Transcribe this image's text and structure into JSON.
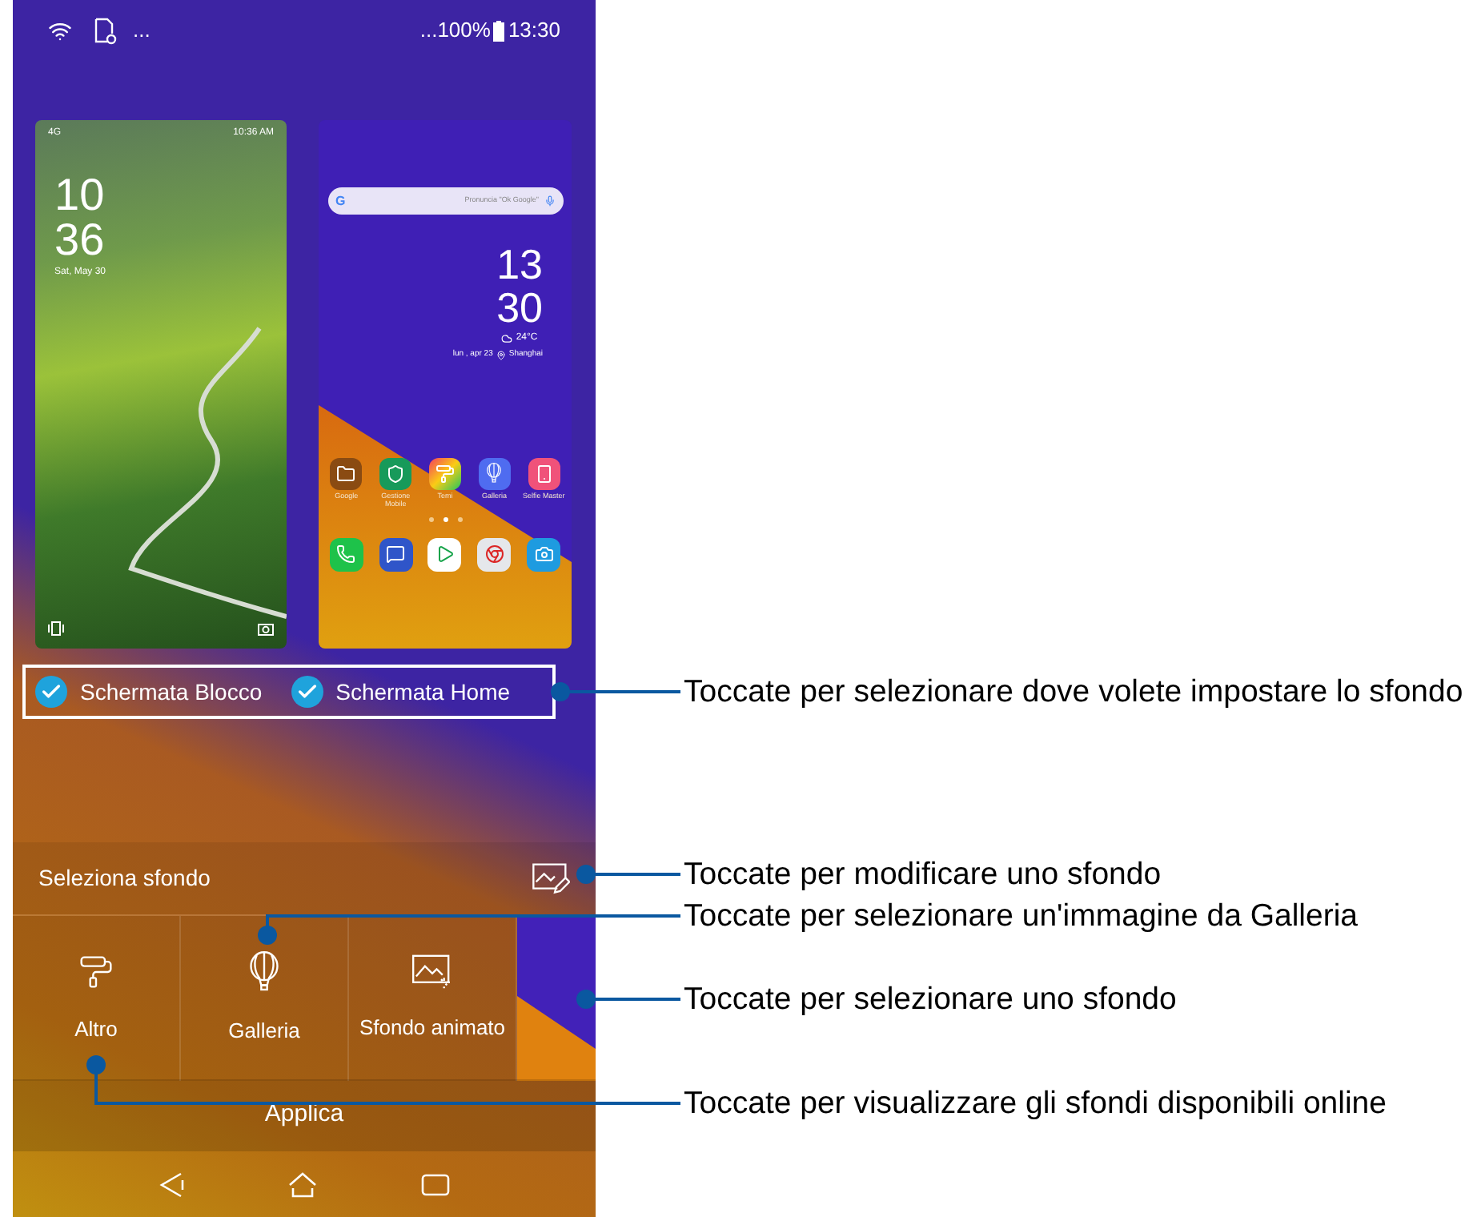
{
  "status_bar": {
    "left_more": "...",
    "right_more": "...",
    "battery": "100%",
    "time": "13:30"
  },
  "lock_preview": {
    "network": "4G",
    "time": "10:36 AM",
    "hour": "10",
    "minute": "36",
    "date": "Sat, May 30"
  },
  "home_preview": {
    "google_logo": "G",
    "search_placeholder": "Pronuncia \"Ok Google\"",
    "hour": "13",
    "minute": "30",
    "temperature": "24°C",
    "date": "lun , apr 23",
    "location": "Shanghai",
    "apps": [
      {
        "label": "Google"
      },
      {
        "label": "Gestione Mobile"
      },
      {
        "label": "Temi"
      },
      {
        "label": "Galleria"
      },
      {
        "label": "Selfie Master"
      }
    ],
    "page_dots": [
      {
        "selected": false
      },
      {
        "selected": true
      },
      {
        "selected": false
      }
    ]
  },
  "targets": [
    {
      "label": "Schermata Blocco",
      "checked": true
    },
    {
      "label": "Schermata Home",
      "checked": true
    }
  ],
  "section_title": "Seleziona sfondo",
  "options": [
    {
      "label": "Altro"
    },
    {
      "label": "Galleria"
    },
    {
      "label": "Sfondo animato"
    }
  ],
  "apply_button": "Applica",
  "callouts": [
    {
      "kind": "targets",
      "text": "Toccate per selezionare dove volete impostare lo sfondo"
    },
    {
      "kind": "edit",
      "text": "Toccate per modificare uno sfondo"
    },
    {
      "kind": "gallery",
      "text": "Toccate per selezionare un'immagine da Galleria"
    },
    {
      "kind": "wallpaper",
      "text": "Toccate per selezionare uno sfondo"
    },
    {
      "kind": "more",
      "text": "Toccate per visualizzare gli sfondi disponibili online"
    }
  ]
}
